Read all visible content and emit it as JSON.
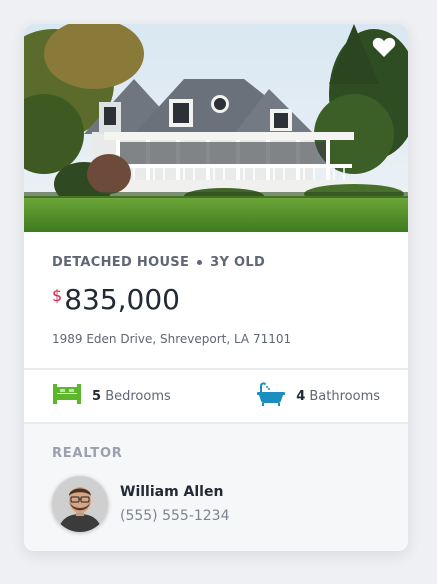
{
  "listing": {
    "type": "DETACHED HOUSE",
    "age": "3Y OLD",
    "currency": "$",
    "price": "835,000",
    "address": "1989 Eden Drive, Shreveport, LA 71101",
    "photo_alt": "Detached house with wraparound porch",
    "favorite_icon": "heart-icon"
  },
  "features": {
    "bedrooms_count": "5",
    "bedrooms_label": "Bedrooms",
    "bedrooms_icon": "bed-icon",
    "bathrooms_count": "4",
    "bathrooms_label": "Bathrooms",
    "bathrooms_icon": "bathtub-icon",
    "bed_color": "#5cb82b",
    "bath_color": "#1a8fbf"
  },
  "realtor": {
    "label": "REALTOR",
    "name": "William Allen",
    "phone": "(555) 555-1234"
  },
  "colors": {
    "accent_currency": "#cf2a4a",
    "text_dark": "#222a36",
    "text_muted": "#5f6775"
  }
}
